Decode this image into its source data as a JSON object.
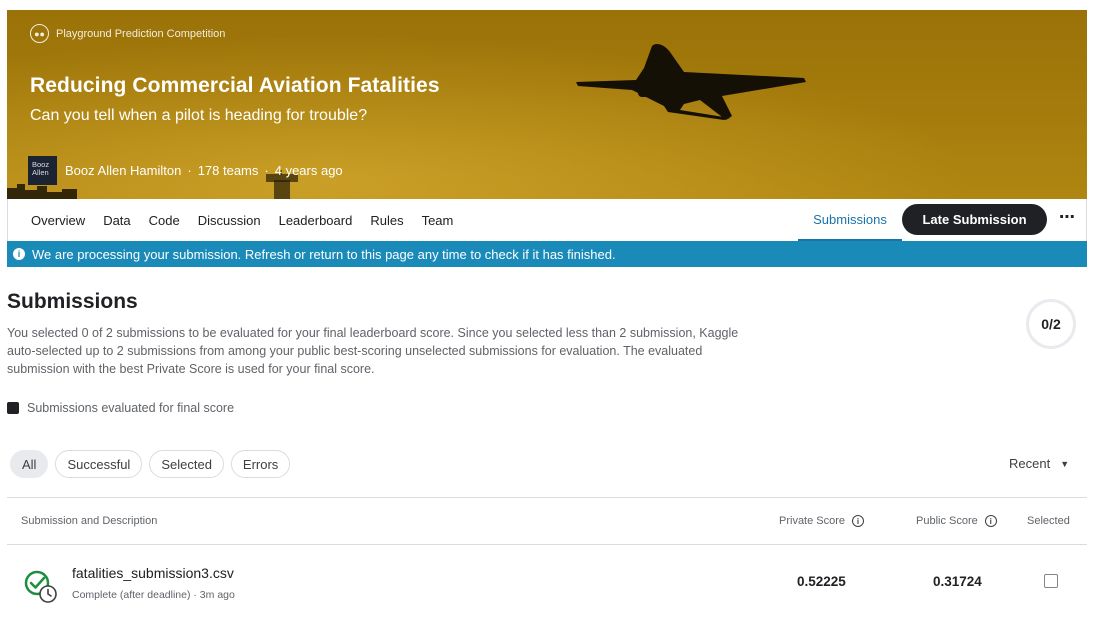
{
  "header": {
    "competition_type": "Playground Prediction Competition",
    "title": "Reducing Commercial Aviation Fatalities",
    "subtitle": "Can you tell when a pilot is heading for trouble?",
    "host_logo_line1": "Booz",
    "host_logo_line2": "Allen",
    "host": "Booz Allen Hamilton",
    "teams": "178 teams",
    "age": "4 years ago",
    "separator": "·"
  },
  "nav": {
    "tabs": [
      "Overview",
      "Data",
      "Code",
      "Discussion",
      "Leaderboard",
      "Rules",
      "Team"
    ],
    "active": "Submissions",
    "late_submission": "Late Submission",
    "more": "⋯"
  },
  "info_banner": {
    "icon": "info-icon",
    "text": "We are processing your submission. Refresh or return to this page any time to check if it has finished."
  },
  "submissions": {
    "title": "Submissions",
    "description": "You selected 0 of 2 submissions to be evaluated for your final leaderboard score. Since you selected less than 2 submission, Kaggle auto-selected up to 2 submissions from among your public best-scoring unselected submissions for evaluation. The evaluated submission with the best Private Score is used for your final score.",
    "progress": "0/2",
    "legend": "Submissions evaluated for final score"
  },
  "filters": {
    "chips": [
      "All",
      "Successful",
      "Selected",
      "Errors"
    ],
    "active": "All",
    "sort": "Recent"
  },
  "table": {
    "headers": {
      "submission": "Submission and Description",
      "private": "Private Score",
      "public": "Public Score",
      "selected": "Selected"
    },
    "rows": [
      {
        "file": "fatalities_submission3.csv",
        "meta": "Complete (after deadline) · 3m ago",
        "private_score": "0.52225",
        "public_score": "0.31724",
        "selected": false
      }
    ]
  },
  "colors": {
    "banner": "#a37a0b",
    "info": "#1a8ab8",
    "accent": "#1a73a8",
    "success": "#1e8e3e"
  }
}
